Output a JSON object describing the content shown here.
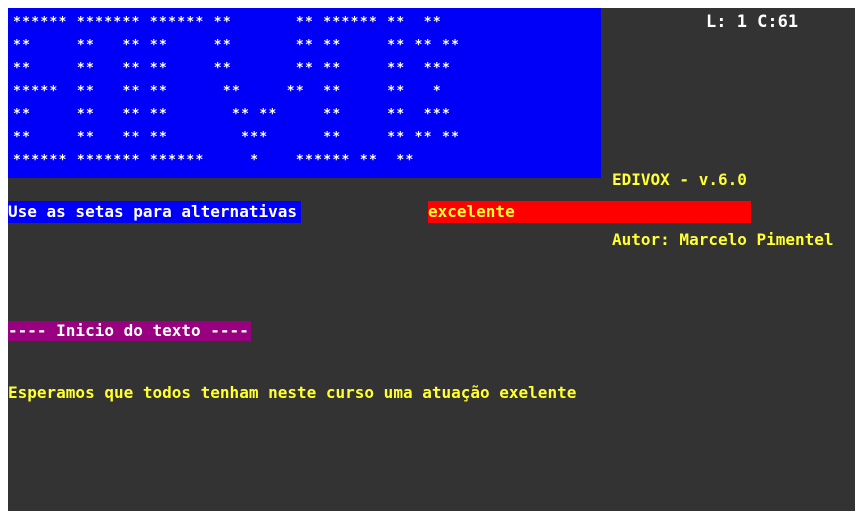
{
  "banner": {
    "art": [
      "****** ******* ****** **       ** ****** **  **",
      "**     **   ** **     **       ** **     ** ** **",
      "**     **   ** **     **       ** **     **  ***",
      "*****  **   ** **      **     **  **     **   *",
      "**     **   ** **       ** **     **     **  ***",
      "**     **   ** **        ***      **     ** ** **",
      "****** ******* ******     *    ****** **  **"
    ]
  },
  "status": {
    "position": "L: 1 C:61"
  },
  "app": {
    "name": "EDIVOX - v.6.0",
    "author": "Autor: Marcelo Pimentel"
  },
  "hint": {
    "label": "Use as setas para alternativas"
  },
  "option": {
    "current": "excelente"
  },
  "editor": {
    "header": "---- Inicio do texto ----",
    "lines": [
      "Esperamos que todos tenham neste curso uma atuação exelente"
    ]
  },
  "colors": {
    "background": "#333333",
    "banner": "#0000f8",
    "highlight": "#ff0000",
    "header": "#990080",
    "text": "#ffff33",
    "white": "#ffffff"
  }
}
